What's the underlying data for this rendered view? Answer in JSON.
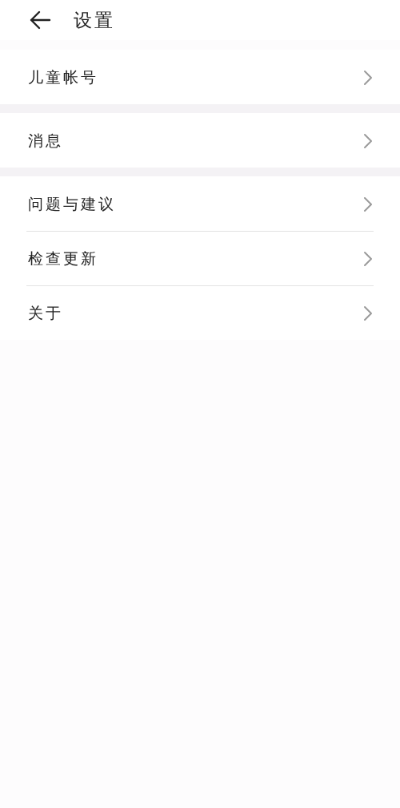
{
  "header": {
    "title": "设置"
  },
  "groups": [
    {
      "items": [
        {
          "label": "儿童帐号"
        }
      ]
    },
    {
      "items": [
        {
          "label": "消息"
        }
      ]
    },
    {
      "items": [
        {
          "label": "问题与建议"
        },
        {
          "label": "检查更新"
        },
        {
          "label": "关于"
        }
      ]
    }
  ]
}
